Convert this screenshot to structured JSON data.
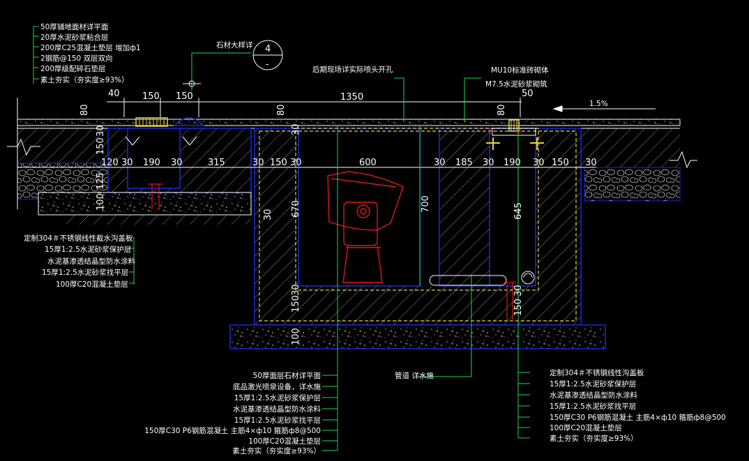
{
  "colors": {
    "background": "#000000",
    "structure_line": "#ffffff",
    "wall_edge": "#1a2bd8",
    "waterproof_layer": "#e8d23c",
    "equipment": "#e01818",
    "leader": "#22d84a",
    "pipe_marker": "#e01818"
  },
  "top_left_notes": [
    "50厚铺地面材详平面",
    "20厚水泥砂浆粘合层",
    "200厚C25混凝土垫层  增加ф1",
    "2钢筋@150  双层双向",
    "200厚级配碎石垫层",
    "素土夯实（夯实度≥93%）"
  ],
  "detail_callout": {
    "label": "石材大样详",
    "number": "4",
    "sheet": "-"
  },
  "mid_note": "后期现场详实际喷头开孔",
  "right_notes": [
    "MU10标准砖砌体",
    "M7.5水泥砂浆砌筑"
  ],
  "slope": "1.5%",
  "dims_top": {
    "d40": "40",
    "d150a": "150",
    "d150b": "150",
    "d1350": "1350",
    "d50": "50"
  },
  "dims_row": [
    "30",
    "190",
    "30",
    "315",
    "30",
    "150",
    "30",
    "600",
    "30",
    "185",
    "30",
    "190",
    "30",
    "150",
    "30"
  ],
  "dims_left_vertical": {
    "v80a": "80",
    "v30": "30",
    "v150": "150",
    "v120": "120",
    "v125": "125",
    "v100": "100"
  },
  "dims_inner": {
    "v80b": "80",
    "v80c": "80",
    "v30b": "30",
    "v670": "670",
    "v700": "700",
    "v645": "645",
    "v30c": "30",
    "v30d": "30",
    "v150b": "150",
    "v150c": "150",
    "v100b": "100",
    "v30e": "30"
  },
  "left_notes": [
    "定制304＃不锈钢线性截水沟盖板",
    "15厚1:2.5水泥砂浆保护层",
    "水泥基渗透结晶型防水涂料",
    "15厚1:2.5水泥砂浆找平层",
    "100厚C20混凝土垫层"
  ],
  "pipe_note": "管道 详水施",
  "bottom_notes": [
    "50厚面层石材详平面",
    "底品激光喷泉设备，详水施",
    "15厚1:2.5水泥砂浆保护层",
    "水泥基渗透结晶型防水涂料",
    "15厚1:2.5水泥砂浆找平层",
    "150厚C30 P6钢筋混凝土 主筋4×ф10  箍筋ф8@500",
    "100厚C20混凝土垫层",
    "素土夯实（夯实度≥93%）"
  ],
  "right_bottom_notes": [
    "定制304＃不锈钢线性沟盖板",
    "15厚1:2.5水泥砂浆保护层",
    "水泥基渗透结晶型防水涂料",
    "15厚1:2.5水泥砂浆找平层",
    "150厚C30 P6钢筋混凝土 主筋4×ф10  箍筋ф8@500",
    "100厚C20混凝土垫层",
    "素土夯实（夯实度≥93%）"
  ]
}
